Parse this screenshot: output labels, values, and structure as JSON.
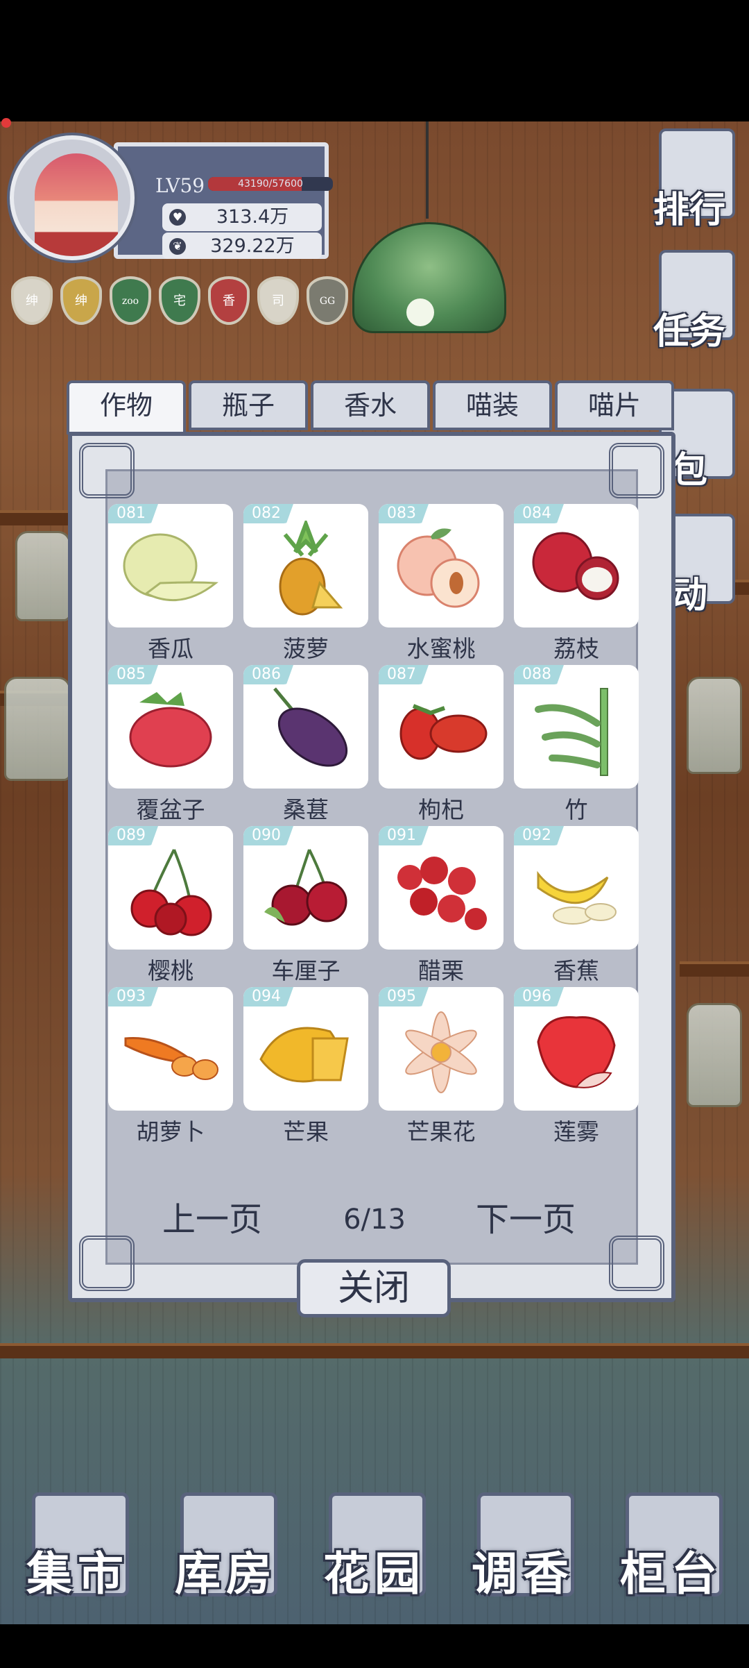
{
  "profile": {
    "level": "LV59",
    "xp_text": "43190/57600",
    "xp_fraction": 0.75,
    "currency1": "313.4万",
    "currency2": "329.22万"
  },
  "badges": [
    {
      "text": "绅",
      "color": "#d8d4c8"
    },
    {
      "text": "绅",
      "color": "#c9a64a"
    },
    {
      "text": "zoo",
      "color": "#3f7a4e"
    },
    {
      "text": "宅",
      "color": "#3f7a4e"
    },
    {
      "text": "香",
      "color": "#b34040"
    },
    {
      "text": "司",
      "color": "#d8d4c8"
    },
    {
      "text": "GG",
      "color": "#7b7b70"
    }
  ],
  "side_menu": {
    "rank": "排行",
    "tasks": "任务",
    "bag": "包",
    "activity": "动"
  },
  "tabs": [
    "作物",
    "瓶子",
    "香水",
    "喵装",
    "喵片"
  ],
  "active_tab": 0,
  "items": [
    {
      "num": "081",
      "name": "香瓜",
      "icon": "melon-icon"
    },
    {
      "num": "082",
      "name": "菠萝",
      "icon": "pineapple-icon"
    },
    {
      "num": "083",
      "name": "水蜜桃",
      "icon": "peach-icon"
    },
    {
      "num": "084",
      "name": "荔枝",
      "icon": "lychee-icon"
    },
    {
      "num": "085",
      "name": "覆盆子",
      "icon": "raspberry-icon"
    },
    {
      "num": "086",
      "name": "桑葚",
      "icon": "mulberry-icon"
    },
    {
      "num": "087",
      "name": "枸杞",
      "icon": "goji-icon"
    },
    {
      "num": "088",
      "name": "竹",
      "icon": "bamboo-icon"
    },
    {
      "num": "089",
      "name": "樱桃",
      "icon": "cherry-icon"
    },
    {
      "num": "090",
      "name": "车厘子",
      "icon": "sweet-cherry-icon"
    },
    {
      "num": "091",
      "name": "醋栗",
      "icon": "currant-icon"
    },
    {
      "num": "092",
      "name": "香蕉",
      "icon": "banana-icon"
    },
    {
      "num": "093",
      "name": "胡萝卜",
      "icon": "carrot-icon"
    },
    {
      "num": "094",
      "name": "芒果",
      "icon": "mango-icon"
    },
    {
      "num": "095",
      "name": "芒果花",
      "icon": "mango-flower-icon"
    },
    {
      "num": "096",
      "name": "莲雾",
      "icon": "wax-apple-icon"
    }
  ],
  "pager": {
    "prev": "上一页",
    "page": "6/13",
    "next": "下一页"
  },
  "close_label": "关闭",
  "bottom_nav": [
    "集市",
    "库房",
    "花园",
    "调香",
    "柜台"
  ]
}
